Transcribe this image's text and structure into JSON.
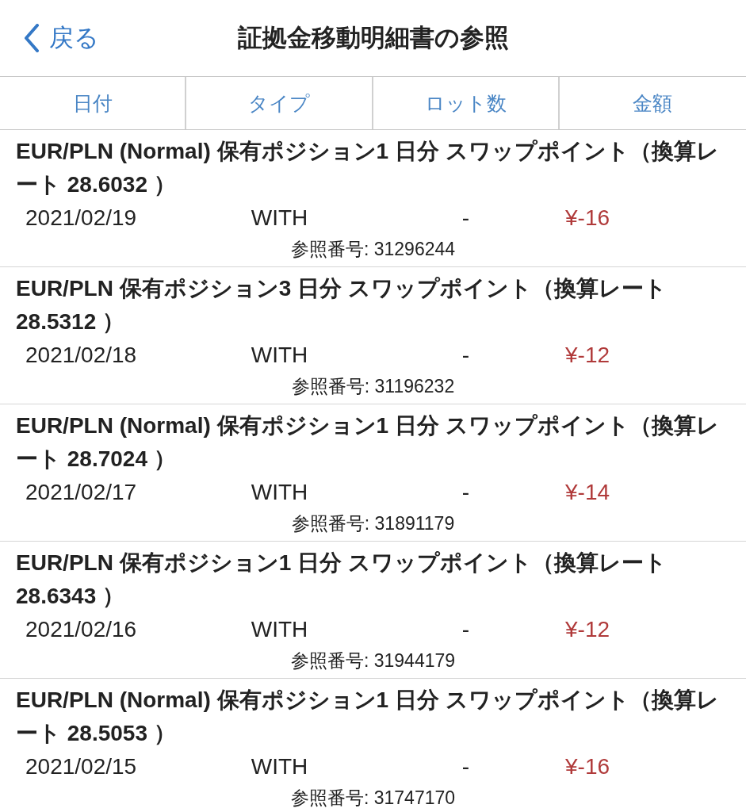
{
  "nav": {
    "back": "戻る",
    "title": "証拠金移動明細書の参照"
  },
  "columns": [
    "日付",
    "タイプ",
    "ロット数",
    "金額"
  ],
  "entries": [
    {
      "description": "EUR/PLN (Normal) 保有ポジション1 日分 スワップポイント（換算レート 28.6032 ）",
      "date": "2021/02/19",
      "type": "WITH",
      "lots": "-",
      "amount": "¥-16",
      "reference": "参照番号: 31296244"
    },
    {
      "description": "EUR/PLN 保有ポジション3 日分 スワップポイント（換算レート 28.5312 ）",
      "date": "2021/02/18",
      "type": "WITH",
      "lots": "-",
      "amount": "¥-12",
      "reference": "参照番号: 31196232"
    },
    {
      "description": "EUR/PLN (Normal) 保有ポジション1 日分 スワップポイント（換算レート 28.7024 ）",
      "date": "2021/02/17",
      "type": "WITH",
      "lots": "-",
      "amount": "¥-14",
      "reference": "参照番号: 31891179"
    },
    {
      "description": "EUR/PLN 保有ポジション1 日分 スワップポイント（換算レート 28.6343 ）",
      "date": "2021/02/16",
      "type": "WITH",
      "lots": "-",
      "amount": "¥-12",
      "reference": "参照番号: 31944179"
    },
    {
      "description": "EUR/PLN (Normal) 保有ポジション1 日分 スワップポイント（換算レート 28.5053 ）",
      "date": "2021/02/15",
      "type": "WITH",
      "lots": "-",
      "amount": "¥-16",
      "reference": "参照番号: 31747170"
    }
  ]
}
